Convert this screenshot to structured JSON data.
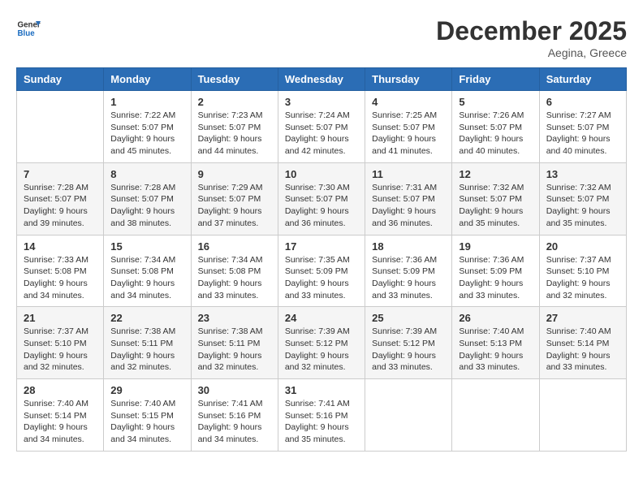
{
  "header": {
    "logo_line1": "General",
    "logo_line2": "Blue",
    "month_title": "December 2025",
    "location": "Aegina, Greece"
  },
  "weekdays": [
    "Sunday",
    "Monday",
    "Tuesday",
    "Wednesday",
    "Thursday",
    "Friday",
    "Saturday"
  ],
  "weeks": [
    [
      {
        "day": "",
        "sunrise": "",
        "sunset": "",
        "daylight": ""
      },
      {
        "day": "1",
        "sunrise": "Sunrise: 7:22 AM",
        "sunset": "Sunset: 5:07 PM",
        "daylight": "Daylight: 9 hours and 45 minutes."
      },
      {
        "day": "2",
        "sunrise": "Sunrise: 7:23 AM",
        "sunset": "Sunset: 5:07 PM",
        "daylight": "Daylight: 9 hours and 44 minutes."
      },
      {
        "day": "3",
        "sunrise": "Sunrise: 7:24 AM",
        "sunset": "Sunset: 5:07 PM",
        "daylight": "Daylight: 9 hours and 42 minutes."
      },
      {
        "day": "4",
        "sunrise": "Sunrise: 7:25 AM",
        "sunset": "Sunset: 5:07 PM",
        "daylight": "Daylight: 9 hours and 41 minutes."
      },
      {
        "day": "5",
        "sunrise": "Sunrise: 7:26 AM",
        "sunset": "Sunset: 5:07 PM",
        "daylight": "Daylight: 9 hours and 40 minutes."
      },
      {
        "day": "6",
        "sunrise": "Sunrise: 7:27 AM",
        "sunset": "Sunset: 5:07 PM",
        "daylight": "Daylight: 9 hours and 40 minutes."
      }
    ],
    [
      {
        "day": "7",
        "sunrise": "Sunrise: 7:28 AM",
        "sunset": "Sunset: 5:07 PM",
        "daylight": "Daylight: 9 hours and 39 minutes."
      },
      {
        "day": "8",
        "sunrise": "Sunrise: 7:28 AM",
        "sunset": "Sunset: 5:07 PM",
        "daylight": "Daylight: 9 hours and 38 minutes."
      },
      {
        "day": "9",
        "sunrise": "Sunrise: 7:29 AM",
        "sunset": "Sunset: 5:07 PM",
        "daylight": "Daylight: 9 hours and 37 minutes."
      },
      {
        "day": "10",
        "sunrise": "Sunrise: 7:30 AM",
        "sunset": "Sunset: 5:07 PM",
        "daylight": "Daylight: 9 hours and 36 minutes."
      },
      {
        "day": "11",
        "sunrise": "Sunrise: 7:31 AM",
        "sunset": "Sunset: 5:07 PM",
        "daylight": "Daylight: 9 hours and 36 minutes."
      },
      {
        "day": "12",
        "sunrise": "Sunrise: 7:32 AM",
        "sunset": "Sunset: 5:07 PM",
        "daylight": "Daylight: 9 hours and 35 minutes."
      },
      {
        "day": "13",
        "sunrise": "Sunrise: 7:32 AM",
        "sunset": "Sunset: 5:07 PM",
        "daylight": "Daylight: 9 hours and 35 minutes."
      }
    ],
    [
      {
        "day": "14",
        "sunrise": "Sunrise: 7:33 AM",
        "sunset": "Sunset: 5:08 PM",
        "daylight": "Daylight: 9 hours and 34 minutes."
      },
      {
        "day": "15",
        "sunrise": "Sunrise: 7:34 AM",
        "sunset": "Sunset: 5:08 PM",
        "daylight": "Daylight: 9 hours and 34 minutes."
      },
      {
        "day": "16",
        "sunrise": "Sunrise: 7:34 AM",
        "sunset": "Sunset: 5:08 PM",
        "daylight": "Daylight: 9 hours and 33 minutes."
      },
      {
        "day": "17",
        "sunrise": "Sunrise: 7:35 AM",
        "sunset": "Sunset: 5:09 PM",
        "daylight": "Daylight: 9 hours and 33 minutes."
      },
      {
        "day": "18",
        "sunrise": "Sunrise: 7:36 AM",
        "sunset": "Sunset: 5:09 PM",
        "daylight": "Daylight: 9 hours and 33 minutes."
      },
      {
        "day": "19",
        "sunrise": "Sunrise: 7:36 AM",
        "sunset": "Sunset: 5:09 PM",
        "daylight": "Daylight: 9 hours and 33 minutes."
      },
      {
        "day": "20",
        "sunrise": "Sunrise: 7:37 AM",
        "sunset": "Sunset: 5:10 PM",
        "daylight": "Daylight: 9 hours and 32 minutes."
      }
    ],
    [
      {
        "day": "21",
        "sunrise": "Sunrise: 7:37 AM",
        "sunset": "Sunset: 5:10 PM",
        "daylight": "Daylight: 9 hours and 32 minutes."
      },
      {
        "day": "22",
        "sunrise": "Sunrise: 7:38 AM",
        "sunset": "Sunset: 5:11 PM",
        "daylight": "Daylight: 9 hours and 32 minutes."
      },
      {
        "day": "23",
        "sunrise": "Sunrise: 7:38 AM",
        "sunset": "Sunset: 5:11 PM",
        "daylight": "Daylight: 9 hours and 32 minutes."
      },
      {
        "day": "24",
        "sunrise": "Sunrise: 7:39 AM",
        "sunset": "Sunset: 5:12 PM",
        "daylight": "Daylight: 9 hours and 32 minutes."
      },
      {
        "day": "25",
        "sunrise": "Sunrise: 7:39 AM",
        "sunset": "Sunset: 5:12 PM",
        "daylight": "Daylight: 9 hours and 33 minutes."
      },
      {
        "day": "26",
        "sunrise": "Sunrise: 7:40 AM",
        "sunset": "Sunset: 5:13 PM",
        "daylight": "Daylight: 9 hours and 33 minutes."
      },
      {
        "day": "27",
        "sunrise": "Sunrise: 7:40 AM",
        "sunset": "Sunset: 5:14 PM",
        "daylight": "Daylight: 9 hours and 33 minutes."
      }
    ],
    [
      {
        "day": "28",
        "sunrise": "Sunrise: 7:40 AM",
        "sunset": "Sunset: 5:14 PM",
        "daylight": "Daylight: 9 hours and 34 minutes."
      },
      {
        "day": "29",
        "sunrise": "Sunrise: 7:40 AM",
        "sunset": "Sunset: 5:15 PM",
        "daylight": "Daylight: 9 hours and 34 minutes."
      },
      {
        "day": "30",
        "sunrise": "Sunrise: 7:41 AM",
        "sunset": "Sunset: 5:16 PM",
        "daylight": "Daylight: 9 hours and 34 minutes."
      },
      {
        "day": "31",
        "sunrise": "Sunrise: 7:41 AM",
        "sunset": "Sunset: 5:16 PM",
        "daylight": "Daylight: 9 hours and 35 minutes."
      },
      {
        "day": "",
        "sunrise": "",
        "sunset": "",
        "daylight": ""
      },
      {
        "day": "",
        "sunrise": "",
        "sunset": "",
        "daylight": ""
      },
      {
        "day": "",
        "sunrise": "",
        "sunset": "",
        "daylight": ""
      }
    ]
  ]
}
